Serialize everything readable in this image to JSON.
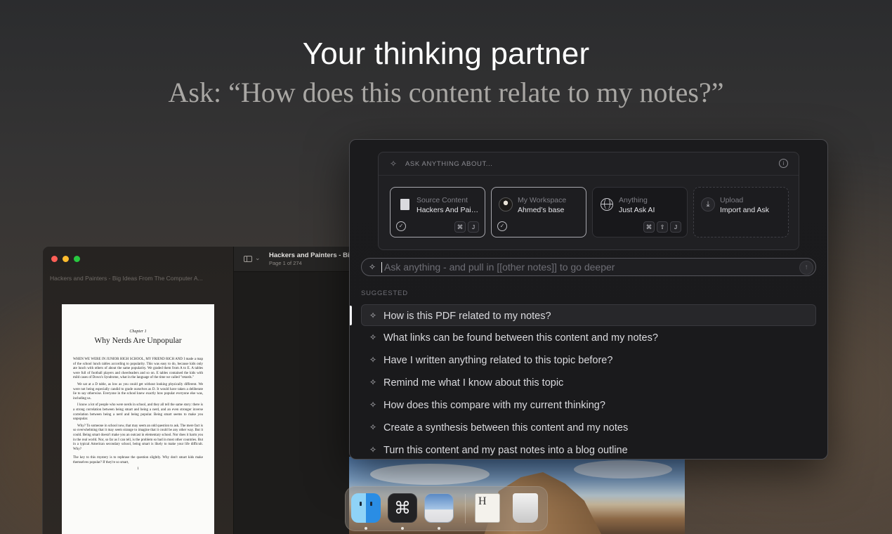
{
  "hero": {
    "headline": "Your thinking partner",
    "subline": "Ask: “How does this content relate to my notes?”"
  },
  "reader": {
    "sidebar_filename": "Hackers and Painters - Big Ideas From The Computer A...",
    "doc_title": "Hackers and Painters - Big",
    "doc_pages": "Page 1 of 274",
    "page": {
      "chapter": "Chapter 1",
      "title": "Why Nerds Are Unpopular",
      "paragraphs": [
        "WHEN WE WERE IN JUNIOR HIGH SCHOOL, MY FRIEND RICH AND I made a map of the school lunch tables according to popularity. This was easy to do, because kids only ate lunch with others of about the same popularity. We graded them from A to E. A tables were full of football players and cheerleaders and so on. E tables contained the kids with mild cases of Down's Syndrome, what in the language of the time we called \"retards.\"",
        "We sat at a D table, as low as you could get without looking physically different. We were not being especially candid to grade ourselves as D. It would have taken a deliberate lie to say otherwise. Everyone in the school knew exactly how popular everyone else was, including us.",
        "I know a lot of people who were nerds in school, and they all tell the same story: there is a strong correlation between being smart and being a nerd, and an even stronger inverse correlation between being a nerd and being popular. Being smart seems to make you unpopular.",
        "Why? To someone in school now, that may seem an odd question to ask. The mere fact is so overwhelming that it may seem strange to imagine that it could be any other way. But it could. Being smart doesn't make you an outcast in elementary school. Nor does it harm you in the real world. Nor, so far as I can tell, is the problem so bad in most other countries. But in a typical American secondary school, being smart is likely to make your life difficult. Why?",
        "The key to this mystery is to rephrase the question slightly. Why don't smart kids make themselves popular? If they're so smart,"
      ],
      "page_number": "1"
    }
  },
  "ask_panel": {
    "context_header": "ASK ANYTHING ABOUT...",
    "sources": [
      {
        "title": "Source Content",
        "subtitle": "Hackers And Painters - Big Ideas",
        "icon": "document-icon",
        "selected": true,
        "keys": [
          "⌘",
          "J"
        ]
      },
      {
        "title": "My Workspace",
        "subtitle": "Ahmed’s base",
        "icon": "avatar-icon",
        "selected": true,
        "keys": []
      },
      {
        "title": "Anything",
        "subtitle": "Just Ask AI",
        "icon": "globe-icon",
        "selected": false,
        "keys": [
          "⌘",
          "⇧",
          "J"
        ]
      },
      {
        "title": "Upload",
        "subtitle": "Import and Ask",
        "icon": "upload-icon",
        "selected": false,
        "keys": []
      }
    ],
    "input_placeholder": "Ask anything - and pull in [[other notes]] to go deeper",
    "suggested_label": "SUGGESTED",
    "suggestions": [
      "How is this PDF related to my notes?",
      "What links can be found between this content and my notes?",
      "Have I written anything related to this topic before?",
      "Remind me what I know about this topic",
      "How does this compare with my current thinking?",
      "Create a synthesis between this content and my notes",
      "Turn this content and my past notes into a blog outline"
    ],
    "active_suggestion": 0
  },
  "dock": {
    "apps": [
      "finder-icon",
      "command-app-icon",
      "preview-icon",
      "document-icon",
      "trash-icon"
    ],
    "running": [
      "finder-icon",
      "command-app-icon",
      "preview-icon"
    ]
  }
}
